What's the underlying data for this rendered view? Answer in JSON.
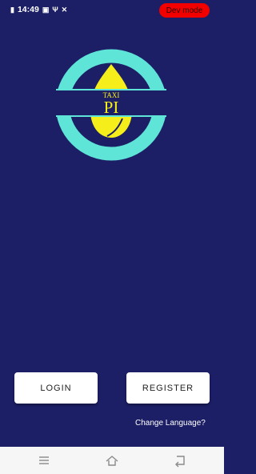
{
  "status_bar": {
    "time": "14:49",
    "icons": [
      "sim-icon",
      "notification-badge-icon",
      "usb-icon",
      "tools-icon"
    ],
    "dev_mode_label": "Dev mode"
  },
  "logo": {
    "top_text": "TAXI",
    "main_text": "PI"
  },
  "actions": {
    "login_label": "LOGIN",
    "register_label": "REGISTER"
  },
  "change_language_label": "Change Language?",
  "nav": {
    "icons": [
      "menu-icon",
      "home-icon",
      "back-icon"
    ]
  },
  "colors": {
    "background": "#1c1f66",
    "ring": "#5ee5d8",
    "flame": "#f6ee1a",
    "dev_badge": "#f20000"
  }
}
